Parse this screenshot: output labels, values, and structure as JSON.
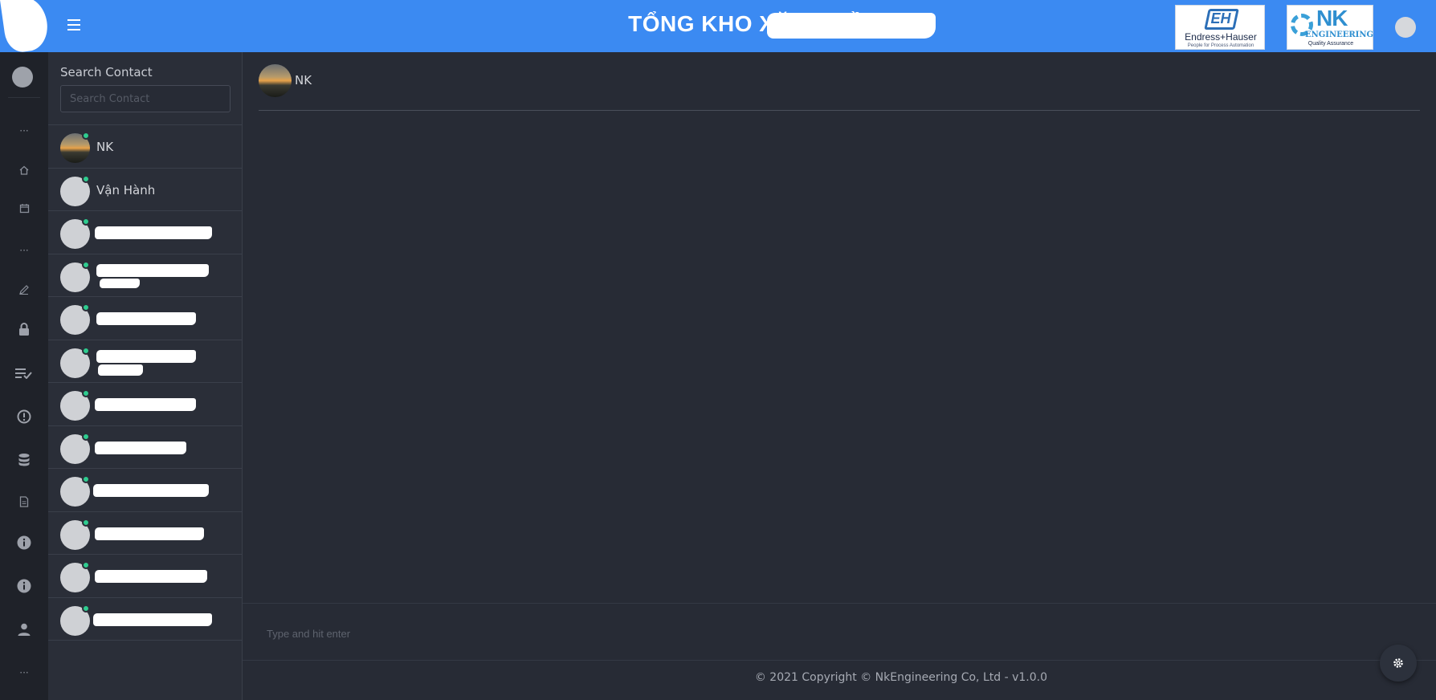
{
  "header": {
    "title": "TỔNG KHO XĂNG DẦ",
    "logo_eh": {
      "mark": "EH",
      "brand": "Endress+Hauser",
      "tagline": "People for Process Automation"
    },
    "logo_nk": {
      "mark": "NK",
      "sub": "ENGINEERING",
      "tagline": "Quality Assurance"
    },
    "accent_color": "#3b8af2"
  },
  "sidebar": {
    "rail_icons": [
      "dots-icon",
      "home-icon",
      "calendar-icon",
      "dots-icon",
      "pencil-icon",
      "lock-icon",
      "checklist-icon",
      "alert-icon",
      "database-icon",
      "document-icon",
      "info-icon",
      "info-icon",
      "user-icon",
      "dots-icon"
    ]
  },
  "contacts": {
    "search_label": "Search Contact",
    "search_placeholder": "Search Contact",
    "items": [
      {
        "name": "NK",
        "photo": true,
        "online": true
      },
      {
        "name": "Vận Hành",
        "photo": false,
        "online": true
      },
      {
        "name": "",
        "photo": false,
        "online": true
      },
      {
        "name": "",
        "photo": false,
        "online": true
      },
      {
        "name": "",
        "photo": false,
        "online": true
      },
      {
        "name": "",
        "photo": false,
        "online": true
      },
      {
        "name": "",
        "photo": false,
        "online": true
      },
      {
        "name": "",
        "photo": false,
        "online": true
      },
      {
        "name": "",
        "photo": false,
        "online": true
      },
      {
        "name": "",
        "photo": false,
        "online": true
      },
      {
        "name": "",
        "photo": false,
        "online": true
      },
      {
        "name": "",
        "photo": false,
        "online": true
      }
    ]
  },
  "chat": {
    "active_contact": "NK",
    "composer_placeholder": "Type and hit enter"
  },
  "footer": {
    "copyright": "© 2021 Copyright © NkEngineering Co, Ltd - v1.0.0"
  }
}
